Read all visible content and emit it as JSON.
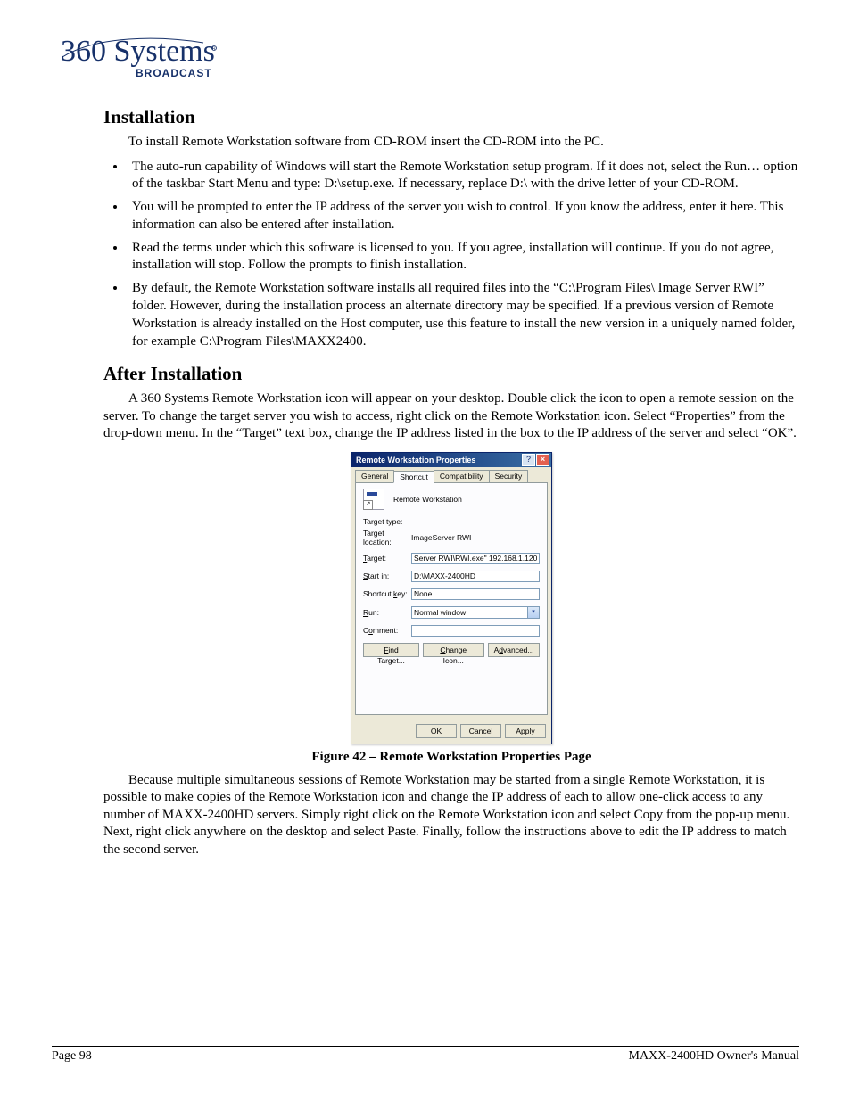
{
  "logo": {
    "text": "360 Systems",
    "sub": "BROADCAST"
  },
  "section1": {
    "title": "Installation",
    "intro": "To install Remote Workstation software from CD-ROM insert the CD-ROM into the PC.",
    "bullets": [
      "The auto-run capability of Windows will start the Remote Workstation setup program.  If it does not, select the Run… option of the taskbar Start Menu and type: D:\\setup.exe. If necessary, replace D:\\ with the drive letter of your CD-ROM.",
      "You will be prompted to enter the IP address of the server you wish to control.  If you know the address, enter it here.  This information can also be entered after installation.",
      "Read the terms under which this software is licensed to you. If you agree, installation will continue. If you do not agree, installation will stop. Follow the prompts to finish installation.",
      "By default, the Remote Workstation software installs all required files into the “C:\\Program Files\\ Image Server RWI” folder. However, during the installation process an alternate directory may be specified. If a previous version of Remote Workstation is already installed on the Host computer, use this feature to install the new version in a uniquely named folder, for example C:\\Program Files\\MAXX2400."
    ]
  },
  "section2": {
    "title": "After Installation",
    "para1": "A 360 Systems Remote Workstation icon will appear on your desktop.  Double click the icon to open a remote session on the server.  To change the target server you wish to access, right click on the Remote Workstation icon.  Select “Properties” from the drop-down menu.  In the “Target” text box, change the IP address listed in the box to the IP address of the server and select “OK”.",
    "para2": "Because multiple simultaneous sessions of Remote Workstation may be started from a single Remote Workstation, it is possible to make copies of the Remote Workstation icon and change the IP address of each to allow one-click access to any number of MAXX-2400HD servers. Simply right click on the Remote Workstation icon and select Copy from the pop-up menu.  Next, right click anywhere on the desktop and select Paste.  Finally, follow the instructions above to edit the IP address to match the second server."
  },
  "figure_caption": "Figure 42 – Remote Workstation Properties Page",
  "dialog": {
    "title": "Remote Workstation Properties",
    "help_btn": "?",
    "close_btn": "×",
    "tabs": [
      "General",
      "Shortcut",
      "Compatibility",
      "Security"
    ],
    "active_tab": 1,
    "icon_label": "Remote Workstation",
    "rows": {
      "target_type_label": "Target type:",
      "target_type_value": "",
      "target_location_label": "Target location:",
      "target_location_value": "ImageServer RWI",
      "target_label": "Target:",
      "target_value": "Server RWI\\RWI.exe\" 192.168.1.120",
      "startin_label": "Start in:",
      "startin_value": "D:\\MAXX-2400HD",
      "shortcut_key_label": "Shortcut key:",
      "shortcut_key_value": "None",
      "run_label": "Run:",
      "run_value": "Normal window",
      "comment_label": "Comment:",
      "comment_value": ""
    },
    "mid_buttons": {
      "find": "Find Target...",
      "change": "Change Icon...",
      "advanced": "Advanced..."
    },
    "bottom_buttons": {
      "ok": "OK",
      "cancel": "Cancel",
      "apply": "Apply"
    }
  },
  "footer": {
    "left": "Page 98",
    "right": "MAXX-2400HD Owner's Manual"
  }
}
